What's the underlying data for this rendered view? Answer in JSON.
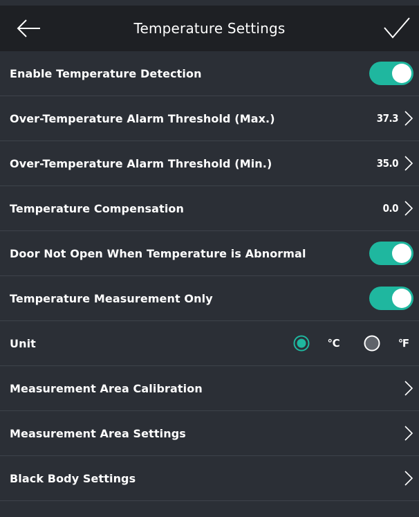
{
  "header": {
    "title": "Temperature Settings",
    "back_icon": "arrow-left-icon",
    "confirm_icon": "checkmark-icon"
  },
  "colors": {
    "background": "#2b2f36",
    "header_background": "#1e2024",
    "accent": "#1fb79f",
    "divider": "#3e434b",
    "radio_off": "#5f636a"
  },
  "settings": [
    {
      "label": "Enable Temperature Detection",
      "control": "toggle",
      "on": true
    },
    {
      "label": "Over-Temperature Alarm Threshold (Max.)",
      "control": "value",
      "value": "37.3"
    },
    {
      "label": "Over-Temperature Alarm Threshold (Min.)",
      "control": "value",
      "value": "35.0"
    },
    {
      "label": "Temperature Compensation",
      "control": "value",
      "value": "0.0"
    },
    {
      "label": "Door Not Open When Temperature is Abnormal",
      "control": "toggle",
      "on": true
    },
    {
      "label": "Temperature Measurement Only",
      "control": "toggle",
      "on": true
    },
    {
      "label": "Unit",
      "control": "radio",
      "options": [
        "℃",
        "℉"
      ],
      "selected": "℃"
    },
    {
      "label": "Measurement Area Calibration",
      "control": "chevron"
    },
    {
      "label": "Measurement Area Settings",
      "control": "chevron"
    },
    {
      "label": "Black Body Settings",
      "control": "chevron"
    }
  ]
}
